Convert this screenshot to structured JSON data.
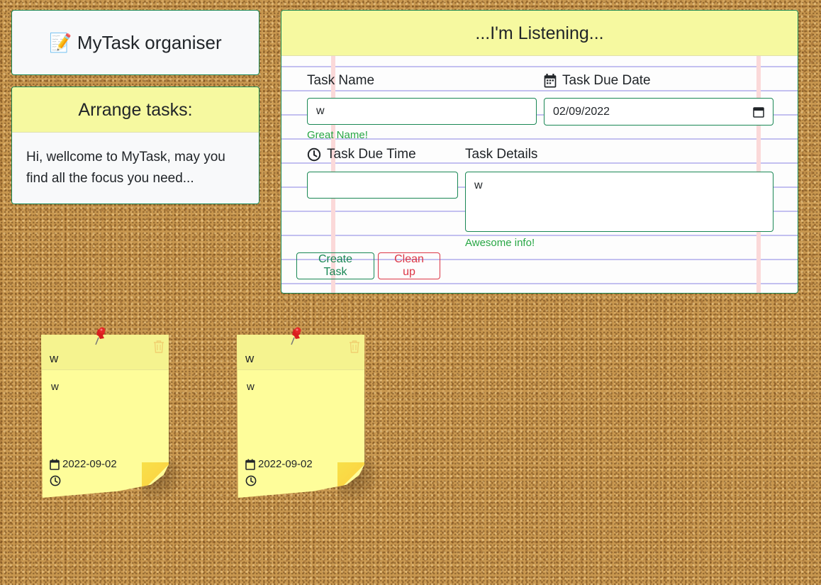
{
  "app": {
    "title": "📝 MyTask organiser"
  },
  "arrange": {
    "header": "Arrange tasks:",
    "message": "Hi, wellcome to MyTask, may you find all the focus you need..."
  },
  "form": {
    "header": "...I'm Listening...",
    "task_name_label": "Task Name",
    "task_name_value": "w",
    "task_name_feedback": "Great Name!",
    "due_date_label": "Task Due Date",
    "due_date_value": "02/09/2022",
    "due_time_label": "Task Due Time",
    "due_time_value": "",
    "details_label": "Task Details",
    "details_value": "w",
    "details_feedback": "Awesome info!",
    "create_button": "Create Task",
    "clean_button": "Clean up"
  },
  "notes": [
    {
      "title": "w",
      "body": "w",
      "date": "2022-09-02",
      "time": ""
    },
    {
      "title": "w",
      "body": "w",
      "date": "2022-09-02",
      "time": ""
    }
  ],
  "colors": {
    "success": "#198754",
    "feedback": "#28a745",
    "danger": "#dc3545",
    "header_yellow": "#f6f9a0",
    "note_yellow": "#fefd9a",
    "cork": "#c8974f"
  },
  "icons": {
    "calendar": "calendar-icon",
    "clock": "clock-icon",
    "trash": "trash-icon",
    "pin": "pushpin-icon"
  }
}
